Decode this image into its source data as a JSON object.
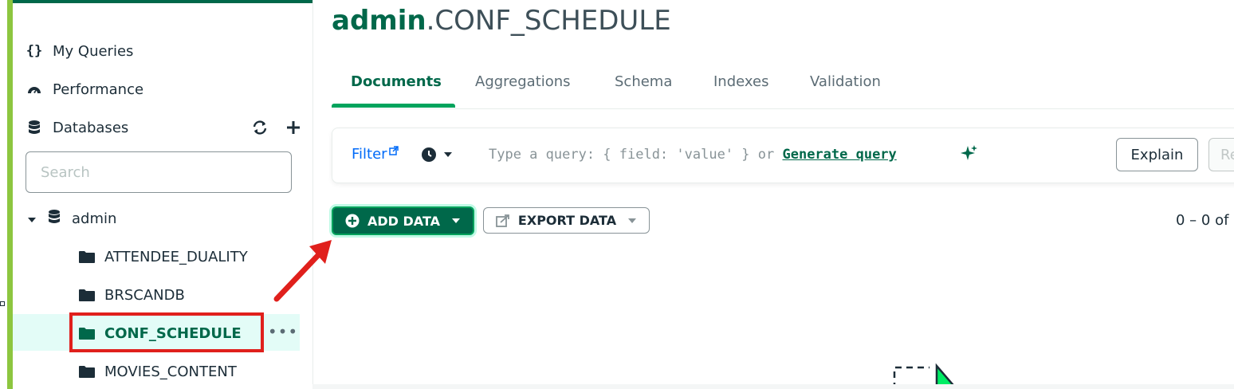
{
  "sidebar": {
    "my_queries": "My Queries",
    "performance": "Performance",
    "databases": "Databases",
    "search_placeholder": "Search",
    "database": "admin",
    "collections": [
      "ATTENDEE_DUALITY",
      "BRSCANDB",
      "CONF_SCHEDULE",
      "MOVIES_CONTENT"
    ],
    "selected_collection": "CONF_SCHEDULE"
  },
  "header": {
    "db": "admin",
    "collection": ".CONF_SCHEDULE"
  },
  "tabs": [
    "Documents",
    "Aggregations",
    "Schema",
    "Indexes",
    "Validation"
  ],
  "active_tab": "Documents",
  "query_bar": {
    "filter_label": "Filter",
    "placeholder_prefix": "Type a query: { field: 'value' } or",
    "generate_link": "Generate query",
    "explain": "Explain",
    "reset": "Re"
  },
  "toolbar": {
    "add_data": "ADD DATA",
    "export_data": "EXPORT DATA",
    "count": "0 – 0 of"
  },
  "colors": {
    "brand_green": "#00684a",
    "accent_green": "#00a35c",
    "highlight_red": "#e0201c",
    "link_blue": "#016bf8"
  }
}
